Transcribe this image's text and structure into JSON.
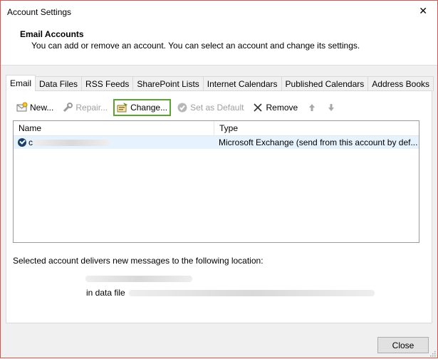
{
  "window": {
    "title": "Account Settings",
    "close_glyph": "✕"
  },
  "header": {
    "title": "Email Accounts",
    "subtitle": "You can add or remove an account. You can select an account and change its settings."
  },
  "tabs": [
    {
      "label": "Email",
      "active": true
    },
    {
      "label": "Data Files"
    },
    {
      "label": "RSS Feeds"
    },
    {
      "label": "SharePoint Lists"
    },
    {
      "label": "Internet Calendars"
    },
    {
      "label": "Published Calendars"
    },
    {
      "label": "Address Books"
    }
  ],
  "toolbar": {
    "new_label": "New...",
    "repair_label": "Repair...",
    "change_label": "Change...",
    "set_default_label": "Set as Default",
    "remove_label": "Remove"
  },
  "list": {
    "columns": {
      "name": "Name",
      "type": "Type"
    },
    "rows": [
      {
        "name_initial": "c",
        "type": "Microsoft Exchange (send from this account by def..."
      }
    ]
  },
  "delivery": {
    "text": "Selected account delivers new messages to the following location:",
    "data_file_label": "in data file"
  },
  "footer": {
    "close_label": "Close"
  },
  "colors": {
    "highlight": "#5aa52f",
    "selected_row": "#e6f3ff",
    "window_border": "#d9534f"
  }
}
